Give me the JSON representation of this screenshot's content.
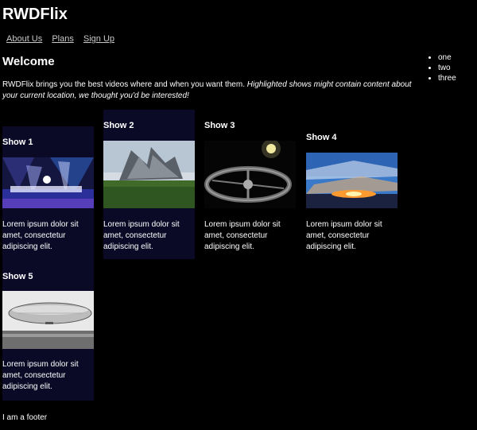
{
  "site": {
    "title": "RWDFlix"
  },
  "nav": {
    "items": [
      "About Us",
      "Plans",
      "Sign Up"
    ]
  },
  "side_list": [
    "one",
    "two",
    "three"
  ],
  "main": {
    "heading": "Welcome",
    "intro_plain": "RWDFlix brings you the best videos where and when you want them.",
    "intro_highlight": "Highlighted shows might contain content about your current location, we thought you'd be interested!"
  },
  "shows": [
    {
      "title": "Show 1",
      "description": "Lorem ipsum dolor sit amet, consectetur adipiscing elit.",
      "highlighted": true,
      "image_icon": "concert-stage-image"
    },
    {
      "title": "Show 2",
      "description": "Lorem ipsum dolor sit amet, consectetur adipiscing elit.",
      "highlighted": true,
      "image_icon": "modern-building-image"
    },
    {
      "title": "Show 3",
      "description": "Lorem ipsum dolor sit amet, consectetur adipiscing elit.",
      "highlighted": false,
      "image_icon": "space-station-image"
    },
    {
      "title": "Show 4",
      "description": "Lorem ipsum dolor sit amet, consectetur adipiscing elit.",
      "highlighted": false,
      "image_icon": "sunset-sky-image"
    },
    {
      "title": "Show 5",
      "description": "Lorem ipsum dolor sit amet, consectetur adipiscing elit.",
      "highlighted": true,
      "image_icon": "airship-image"
    }
  ],
  "footer": {
    "text": "I am a footer"
  },
  "colors": {
    "background": "#000000",
    "highlight_card": "#0b0a26",
    "text": "#ffffff",
    "nav_link": "#c8c8c8"
  }
}
